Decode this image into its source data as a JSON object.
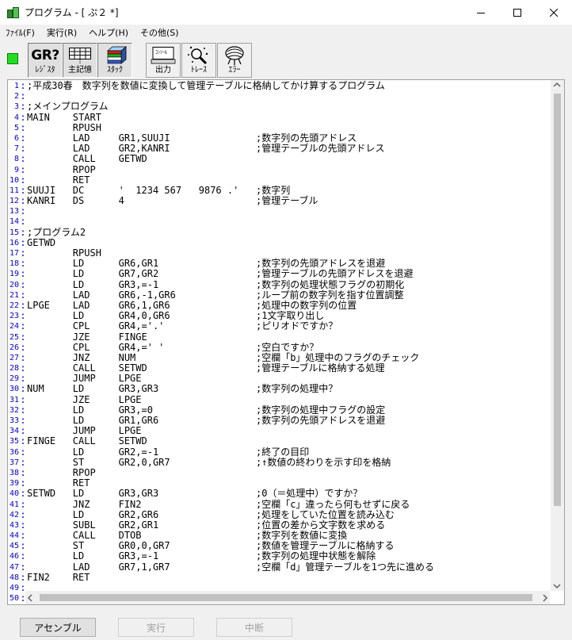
{
  "window": {
    "title": "プログラム - [ ぷ２ *]"
  },
  "menu": {
    "items": [
      {
        "label": "ﾌｧｲﾙ(F)"
      },
      {
        "label": "実行(R)"
      },
      {
        "label": "ヘルプ(H)"
      },
      {
        "label": "その他(S)"
      }
    ]
  },
  "toolbar": {
    "register_icon_text": "GR?",
    "register_label": "ﾚｼﾞｽﾀ",
    "memory_label": "主記憶",
    "stack_label": "ｽﾀｯｸ",
    "output_icon_text": "ｺﾝｿｰﾙ",
    "output_label": "出力",
    "trace_label": "ﾄﾚｰｽ",
    "error_label": "ｴﾗｰ"
  },
  "code": {
    "lines": [
      ";平成30春　数字列を数値に変換して管理テーブルに格納してかけ算するプログラム",
      "",
      ";メインプログラム",
      "MAIN    START",
      "        RPUSH",
      "        LAD     GR1,SUUJI               ;数字列の先頭アドレス",
      "        LAD     GR2,KANRI               ;管理テーブルの先頭アドレス",
      "        CALL    GETWD",
      "        RPOP",
      "        RET",
      "SUUJI   DC      '  1234 567   9876 .'   ;数字列",
      "KANRI   DS      4                       ;管理テーブル",
      "",
      "",
      ";プログラム2",
      "GETWD",
      "        RPUSH",
      "        LD      GR6,GR1                 ;数字列の先頭アドレスを退避",
      "        LD      GR7,GR2                 ;管理テーブルの先頭アドレスを退避",
      "        LD      GR3,=-1                 ;数字列の処理状態フラグの初期化",
      "        LAD     GR6,-1,GR6              ;ループ前の数字列を指す位置調整",
      "LPGE    LAD     GR6,1,GR6               ;処理中の数字列の位置",
      "        LD      GR4,0,GR6               ;1文字取り出し",
      "        CPL     GR4,='.'                ;ピリオドですか？",
      "        JZE     FINGE",
      "        CPL     GR4,=' '                ;空白ですか？",
      "        JNZ     NUM                     ;空欄「b」処理中のフラグのチェック",
      "        CALL    SETWD                   ;管理テーブルに格納する処理",
      "        JUMP    LPGE",
      "NUM     LD      GR3,GR3                 ;数字列の処理中？",
      "        JZE     LPGE",
      "        LD      GR3,=0                  ;数字列の処理中フラグの設定",
      "        LD      GR1,GR6                 ;数字列の先頭アドレスを退避",
      "        JUMP    LPGE",
      "FINGE   CALL    SETWD",
      "        LD      GR2,=-1                 ;終了の目印",
      "        ST      GR2,0,GR7               ;↑数値の終わりを示す印を格納",
      "        RPOP",
      "        RET",
      "SETWD   LD      GR3,GR3                 ;0（＝処理中）ですか？",
      "        JNZ     FIN2                    ;空欄「c」違ったら何もせずに戻る",
      "        LD      GR2,GR6                 ;処理をしていた位置を読み込む",
      "        SUBL    GR2,GR1                 ;位置の差から文字数を求める",
      "        CALL    DTOB                    ;数字列を数値に変換",
      "        ST      GR0,0,GR7               ;数値を管理テーブルに格納する",
      "        LD      GR3,=-1                 ;数字列の処理中状態を解除",
      "        LAD     GR7,1,GR7               ;空欄「d」管理テーブルを1つ先に進める",
      "FIN2    RET",
      "",
      "",
      ""
    ]
  },
  "buttons": {
    "assemble_label": "アセンブル",
    "run_label": "実行",
    "stop_label": "中断"
  },
  "colors": {
    "line_number": "#0000cc",
    "run_indicator": "#22dd22"
  }
}
